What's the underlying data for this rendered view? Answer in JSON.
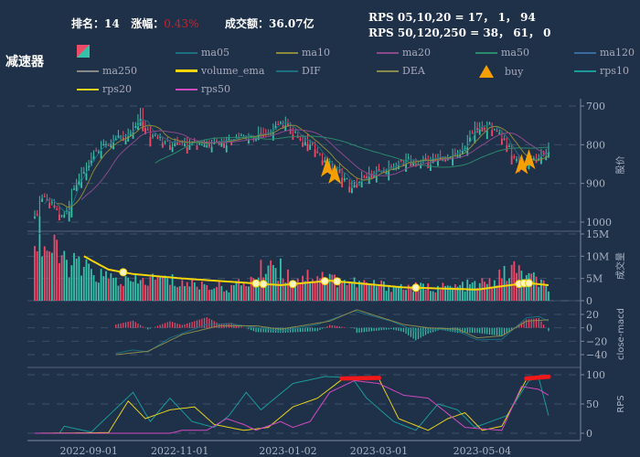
{
  "header": {
    "rank_label": "排名：",
    "rank": "14",
    "change_label": "涨幅：",
    "change": "0.43%",
    "amount_label": "成交额：",
    "amount": "36.07亿",
    "rps_line1": "RPS 05,10,20 = 17， 1， 94",
    "rps_line2": "RPS 50,120,250 = 38， 61， 0",
    "title": "减速器"
  },
  "legend": [
    {
      "name": "ma05",
      "color": "#1c6f80"
    },
    {
      "name": "ma10",
      "color": "#8a8a3a"
    },
    {
      "name": "ma20",
      "color": "#8a4a8a"
    },
    {
      "name": "ma50",
      "color": "#2a8a6a"
    },
    {
      "name": "ma120",
      "color": "#3a6aa0"
    },
    {
      "name": "ma250",
      "color": "#888888"
    },
    {
      "name": "volume_ema",
      "color": "#f5d40a"
    },
    {
      "name": "DIF",
      "color": "#1c6f80"
    },
    {
      "name": "DEA",
      "color": "#8a8a4a"
    },
    {
      "name": "buy",
      "color": "#f5a000"
    },
    {
      "name": "rps10",
      "color": "#1a9a9a"
    },
    {
      "name": "rps20",
      "color": "#e6d21a"
    },
    {
      "name": "rps50",
      "color": "#d04ac0"
    }
  ],
  "colors": {
    "up": "#ee4b68",
    "down": "#36c2a8",
    "bg": "#1f3049"
  },
  "chart_data": {
    "type": "candlestick",
    "bars": 210,
    "x_tick_labels": [
      {
        "i": 22,
        "label": "2022-09-01"
      },
      {
        "i": 59,
        "label": "2022-11-01"
      },
      {
        "i": 103,
        "label": "2023-01-02"
      },
      {
        "i": 140,
        "label": "2023-03-01"
      },
      {
        "i": 182,
        "label": "2023-05-04"
      }
    ],
    "panels": [
      {
        "id": "price",
        "ylabel": "股价",
        "ylim": [
          685,
          1005
        ],
        "ticks": [
          "700",
          "800",
          "900",
          "1000"
        ],
        "close_anchors": [
          [
            0,
            990
          ],
          [
            3,
            930
          ],
          [
            8,
            960
          ],
          [
            12,
            980
          ],
          [
            16,
            900
          ],
          [
            23,
            830
          ],
          [
            30,
            790
          ],
          [
            38,
            765
          ],
          [
            43,
            720
          ],
          [
            47,
            780
          ],
          [
            53,
            790
          ],
          [
            60,
            800
          ],
          [
            71,
            800
          ],
          [
            83,
            785
          ],
          [
            94,
            765
          ],
          [
            101,
            740
          ],
          [
            105,
            765
          ],
          [
            112,
            800
          ],
          [
            120,
            850
          ],
          [
            129,
            905
          ],
          [
            135,
            875
          ],
          [
            142,
            860
          ],
          [
            149,
            840
          ],
          [
            157,
            840
          ],
          [
            168,
            830
          ],
          [
            175,
            800
          ],
          [
            179,
            745
          ],
          [
            187,
            755
          ],
          [
            192,
            800
          ],
          [
            198,
            855
          ],
          [
            205,
            825
          ],
          [
            209,
            805
          ]
        ],
        "buy_signals": [
          119,
          122,
          198,
          201
        ]
      },
      {
        "id": "volume",
        "ylabel": "成交量",
        "ylim": [
          0,
          15
        ],
        "unit": "M",
        "ticks": [
          "0",
          "5M",
          "10M",
          "15M"
        ],
        "volume_anchors": [
          [
            0,
            15
          ],
          [
            5,
            12
          ],
          [
            12,
            9
          ],
          [
            20,
            7
          ],
          [
            30,
            5
          ],
          [
            40,
            4
          ],
          [
            50,
            5
          ],
          [
            60,
            4
          ],
          [
            80,
            3
          ],
          [
            90,
            5
          ],
          [
            95,
            9
          ],
          [
            105,
            5
          ],
          [
            115,
            6
          ],
          [
            120,
            5
          ],
          [
            130,
            4
          ],
          [
            150,
            3
          ],
          [
            170,
            3
          ],
          [
            185,
            4
          ],
          [
            195,
            7
          ],
          [
            209,
            3
          ]
        ],
        "ema_anchors": [
          [
            20,
            10
          ],
          [
            30,
            7
          ],
          [
            40,
            6
          ],
          [
            60,
            5
          ],
          [
            100,
            3.5
          ],
          [
            120,
            4.5
          ],
          [
            150,
            3
          ],
          [
            180,
            2.5
          ],
          [
            200,
            4
          ],
          [
            209,
            3.5
          ]
        ],
        "highlights": [
          36,
          90,
          93,
          105,
          118,
          123,
          155,
          197,
          199,
          201
        ]
      },
      {
        "id": "macd",
        "ylabel": "close-macd",
        "ylim": [
          -45,
          30
        ],
        "ticks": [
          "−40",
          "−20",
          "0",
          "20"
        ],
        "dif": [
          [
            33,
            -38
          ],
          [
            40,
            -33
          ],
          [
            46,
            -36
          ],
          [
            55,
            -15
          ],
          [
            70,
            5
          ],
          [
            80,
            6
          ],
          [
            100,
            -5
          ],
          [
            115,
            5
          ],
          [
            130,
            25
          ],
          [
            145,
            10
          ],
          [
            155,
            -5
          ],
          [
            165,
            -2
          ],
          [
            172,
            -5
          ],
          [
            180,
            -18
          ],
          [
            190,
            -17
          ],
          [
            200,
            15
          ],
          [
            205,
            17
          ],
          [
            209,
            10
          ]
        ],
        "dea": [
          [
            33,
            -40
          ],
          [
            46,
            -35
          ],
          [
            60,
            -10
          ],
          [
            75,
            3
          ],
          [
            90,
            3
          ],
          [
            100,
            -2
          ],
          [
            120,
            10
          ],
          [
            131,
            27
          ],
          [
            150,
            5
          ],
          [
            160,
            0
          ],
          [
            172,
            -2
          ],
          [
            180,
            -15
          ],
          [
            190,
            -12
          ],
          [
            200,
            10
          ],
          [
            209,
            12
          ]
        ]
      },
      {
        "id": "rps",
        "ylabel": "RPS",
        "ylim": [
          -5,
          105
        ],
        "ticks": [
          "0",
          "50",
          "100"
        ],
        "rps10": [
          [
            0,
            0
          ],
          [
            10,
            0
          ],
          [
            12,
            12
          ],
          [
            23,
            2
          ],
          [
            40,
            70
          ],
          [
            47,
            20
          ],
          [
            55,
            60
          ],
          [
            64,
            20
          ],
          [
            73,
            10
          ],
          [
            79,
            30
          ],
          [
            86,
            70
          ],
          [
            92,
            40
          ],
          [
            105,
            85
          ],
          [
            118,
            97
          ],
          [
            129,
            95
          ],
          [
            135,
            60
          ],
          [
            146,
            20
          ],
          [
            155,
            5
          ],
          [
            164,
            50
          ],
          [
            172,
            40
          ],
          [
            179,
            10
          ],
          [
            192,
            30
          ],
          [
            201,
            90
          ],
          [
            205,
            95
          ],
          [
            209,
            30
          ]
        ],
        "rps20": [
          [
            0,
            0
          ],
          [
            30,
            1
          ],
          [
            38,
            55
          ],
          [
            45,
            25
          ],
          [
            55,
            40
          ],
          [
            65,
            45
          ],
          [
            73,
            15
          ],
          [
            85,
            5
          ],
          [
            95,
            10
          ],
          [
            105,
            45
          ],
          [
            115,
            60
          ],
          [
            125,
            92
          ],
          [
            140,
            93
          ],
          [
            148,
            25
          ],
          [
            160,
            5
          ],
          [
            168,
            25
          ],
          [
            175,
            35
          ],
          [
            182,
            5
          ],
          [
            190,
            12
          ],
          [
            200,
            92
          ],
          [
            209,
            95
          ]
        ],
        "rps50": [
          [
            0,
            0
          ],
          [
            55,
            0
          ],
          [
            60,
            5
          ],
          [
            70,
            5
          ],
          [
            78,
            25
          ],
          [
            85,
            15
          ],
          [
            90,
            5
          ],
          [
            100,
            20
          ],
          [
            105,
            10
          ],
          [
            112,
            20
          ],
          [
            120,
            70
          ],
          [
            130,
            90
          ],
          [
            140,
            85
          ],
          [
            150,
            65
          ],
          [
            160,
            60
          ],
          [
            175,
            10
          ],
          [
            190,
            5
          ],
          [
            198,
            80
          ],
          [
            205,
            75
          ],
          [
            209,
            65
          ]
        ]
      }
    ]
  }
}
